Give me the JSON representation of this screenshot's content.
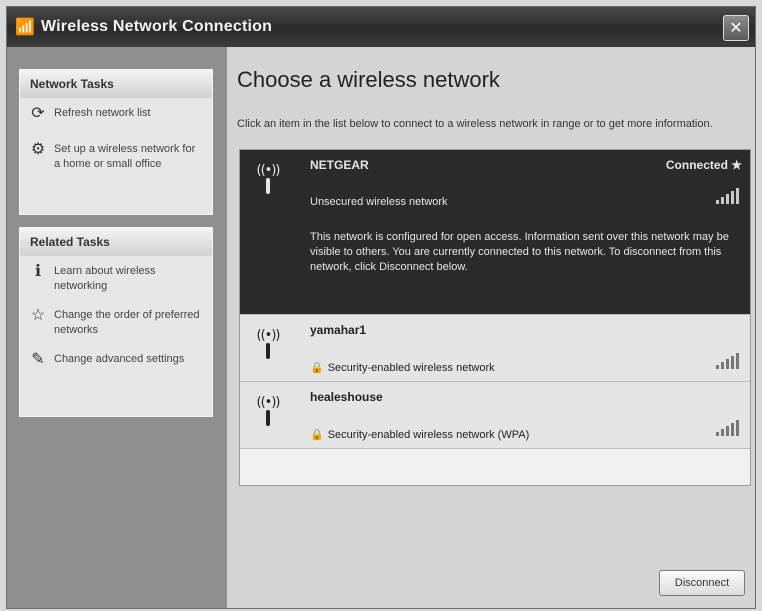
{
  "window": {
    "title": "Wireless Network Connection",
    "close_label": "✕"
  },
  "sidebar": {
    "network_tasks": {
      "header": "Network Tasks",
      "items": [
        {
          "label": "Refresh network list",
          "icon": "refresh-icon"
        },
        {
          "label": "Set up a wireless network for a home or small office",
          "icon": "setup-wizard-icon"
        }
      ]
    },
    "related_tasks": {
      "header": "Related Tasks",
      "items": [
        {
          "label": "Learn about wireless networking",
          "icon": "info-icon"
        },
        {
          "label": "Change the order of preferred networks",
          "icon": "star-icon"
        },
        {
          "label": "Change advanced settings",
          "icon": "settings-icon"
        }
      ]
    }
  },
  "main": {
    "title": "Choose a wireless network",
    "description": "Click an item in the list below to connect to a wireless network in range or to get more information.",
    "networks": [
      {
        "name": "NETGEAR",
        "status": "Connected ★",
        "security": "Unsecured wireless network",
        "info": "This network is configured for open access. Information sent over this network may be visible to others. You are currently connected to this network. To disconnect from this network, click Disconnect below.",
        "signal_bars": 5
      },
      {
        "name": "yamahar1",
        "security": "Security-enabled wireless network",
        "signal_bars": 5
      },
      {
        "name": "healeshouse",
        "security": "Security-enabled wireless network (WPA)",
        "signal_bars": 5
      }
    ],
    "disconnect_label": "Disconnect"
  }
}
